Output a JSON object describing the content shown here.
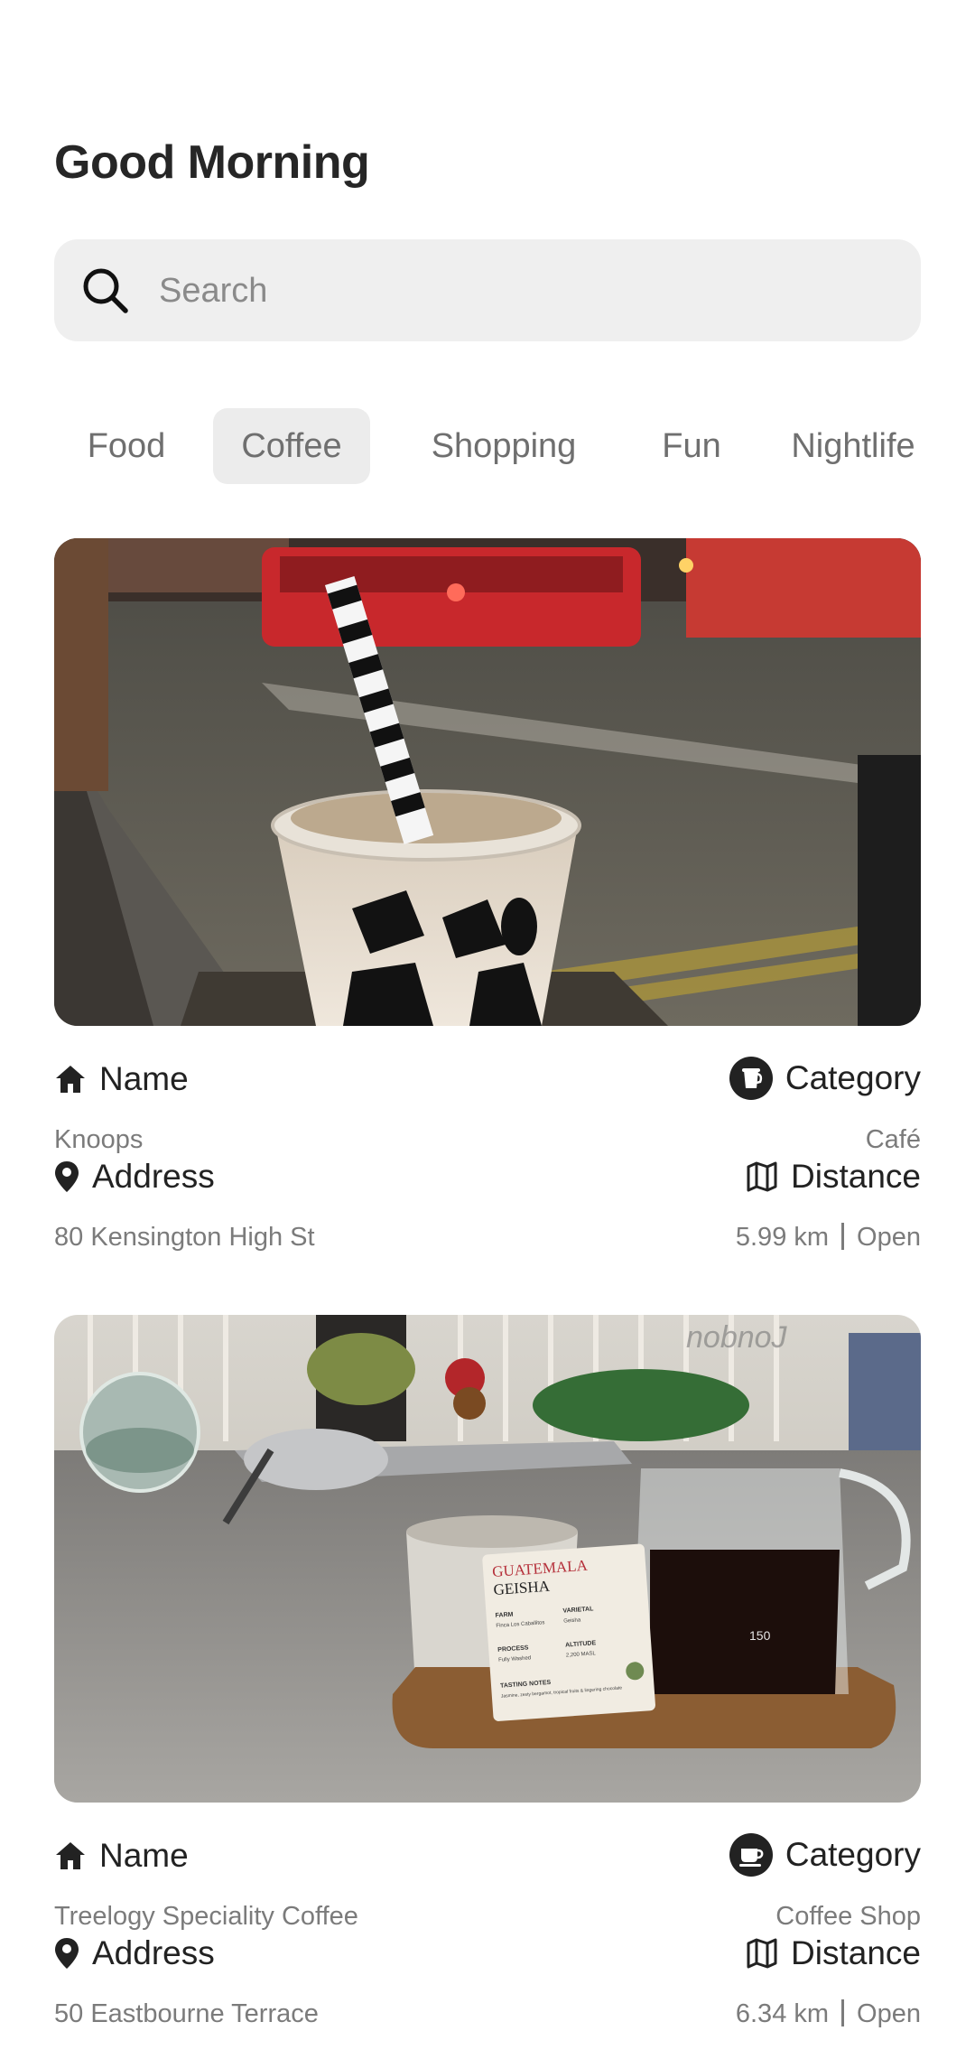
{
  "header": {
    "greeting": "Good Morning"
  },
  "search": {
    "placeholder": "Search",
    "icon": "search-icon"
  },
  "tabs": [
    {
      "label": "Food",
      "active": false
    },
    {
      "label": "Coffee",
      "active": true
    },
    {
      "label": "Shopping",
      "active": false
    },
    {
      "label": "Fun",
      "active": false
    },
    {
      "label": "Nightlife",
      "active": false
    }
  ],
  "field_labels": {
    "name": "Name",
    "category": "Category",
    "address": "Address",
    "distance": "Distance"
  },
  "places": [
    {
      "photo_icon": "iced-coffee-photo",
      "name": "Knoops",
      "category": "Café",
      "address": "80 Kensington High St",
      "distance": "5.99 km",
      "status": "Open"
    },
    {
      "photo_icon": "pour-over-coffee-photo",
      "name": "Treelogy Speciality Coffee",
      "category": "Coffee Shop",
      "address": "50 Eastbourne Terrace",
      "distance": "6.34 km",
      "status": "Open",
      "photo_text": {
        "watermark": "nobnoJ",
        "card_origin": "GUATEMALA",
        "card_variety_name": "GEISHA",
        "farm_label": "FARM",
        "farm_value": "Finca Los Caballitos",
        "varietal_label": "VARIETAL",
        "varietal_value": "Geisha",
        "process_label": "PROCESS",
        "process_value": "Fully Washed",
        "altitude_label": "ALTITUDE",
        "altitude_value": "2,200 MASL",
        "notes_label": "TASTING NOTES",
        "notes_value": "Jasmine, zesty bergamot, tropical fruits & lingering chocolate",
        "jug_mark": "150"
      }
    }
  ],
  "colors": {
    "accent_tab_bg": "#ececec",
    "search_bg": "#efefef",
    "muted_text": "#7b7b7b"
  }
}
